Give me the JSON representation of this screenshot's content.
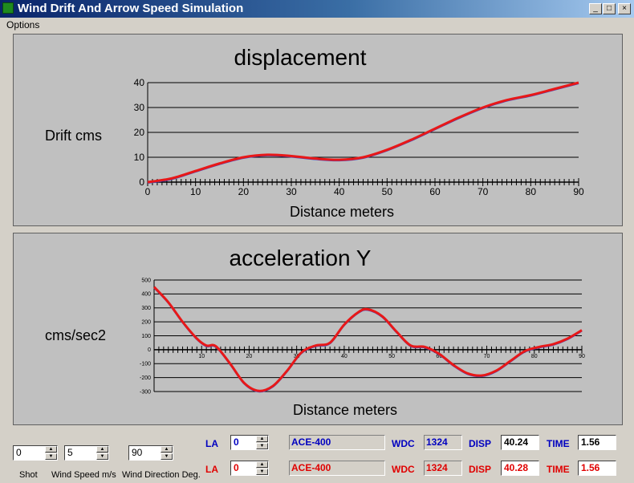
{
  "window": {
    "title": "Wind Drift And Arrow Speed Simulation"
  },
  "menu": {
    "options": "Options"
  },
  "colors": {
    "curve": "#e81818",
    "curve_shadow": "#4040c0",
    "blue_text": "#0000c0",
    "red_text": "#e00000"
  },
  "chart_data": [
    {
      "type": "line",
      "title": "displacement",
      "xlabel": "Distance meters",
      "ylabel": "Drift cms",
      "xlim": [
        0,
        90
      ],
      "ylim": [
        0,
        40
      ],
      "xticks": [
        0,
        10,
        20,
        30,
        40,
        50,
        60,
        70,
        80,
        90
      ],
      "yticks": [
        0,
        10,
        20,
        30,
        40
      ],
      "grid": true,
      "x": [
        0,
        5,
        10,
        15,
        20,
        25,
        30,
        35,
        40,
        45,
        50,
        55,
        60,
        65,
        70,
        75,
        80,
        85,
        90
      ],
      "y": [
        0,
        1.5,
        4.5,
        7.5,
        10,
        11,
        10.5,
        9.5,
        9,
        10,
        13,
        17,
        21.5,
        26,
        30,
        33,
        35,
        37.5,
        40
      ]
    },
    {
      "type": "line",
      "title": "acceleration Y",
      "xlabel": "Distance meters",
      "ylabel": "cms/sec2",
      "xlim": [
        0,
        90
      ],
      "ylim": [
        -300,
        500
      ],
      "xticks": [
        10,
        20,
        30,
        40,
        50,
        60,
        70,
        80,
        90
      ],
      "yticks": [
        500,
        400,
        300,
        200,
        100,
        0,
        -100,
        -200,
        -300
      ],
      "grid": true,
      "x": [
        0,
        3,
        6,
        9,
        11,
        13,
        16,
        19,
        22,
        25,
        28,
        31,
        34,
        37,
        40,
        43,
        45,
        48,
        51,
        54,
        57,
        60,
        63,
        66,
        69,
        72,
        75,
        78,
        81,
        84,
        87,
        90
      ],
      "y": [
        450,
        340,
        200,
        80,
        30,
        25,
        -100,
        -240,
        -295,
        -260,
        -150,
        -20,
        30,
        50,
        180,
        270,
        290,
        240,
        130,
        30,
        20,
        -30,
        -110,
        -170,
        -185,
        -150,
        -80,
        -10,
        20,
        40,
        80,
        140
      ]
    }
  ],
  "controls": {
    "shot": {
      "label": "Shot",
      "value": "0"
    },
    "wind_speed": {
      "label": "Wind Speed m/s",
      "value": "5"
    },
    "wind_direction": {
      "label": "Wind Direction Deg.",
      "value": "90"
    }
  },
  "rows": [
    {
      "la_label": "LA",
      "la_value": "0",
      "name": "ACE-400",
      "wdc_label": "WDC",
      "wdc": "1324",
      "disp_label": "DISP",
      "disp": "40.24",
      "time_label": "TIME",
      "time": "1.56"
    },
    {
      "la_label": "LA",
      "la_value": "0",
      "name": "ACE-400",
      "wdc_label": "WDC",
      "wdc": "1324",
      "disp_label": "DISP",
      "disp": "40.28",
      "time_label": "TIME",
      "time": "1.56"
    }
  ]
}
